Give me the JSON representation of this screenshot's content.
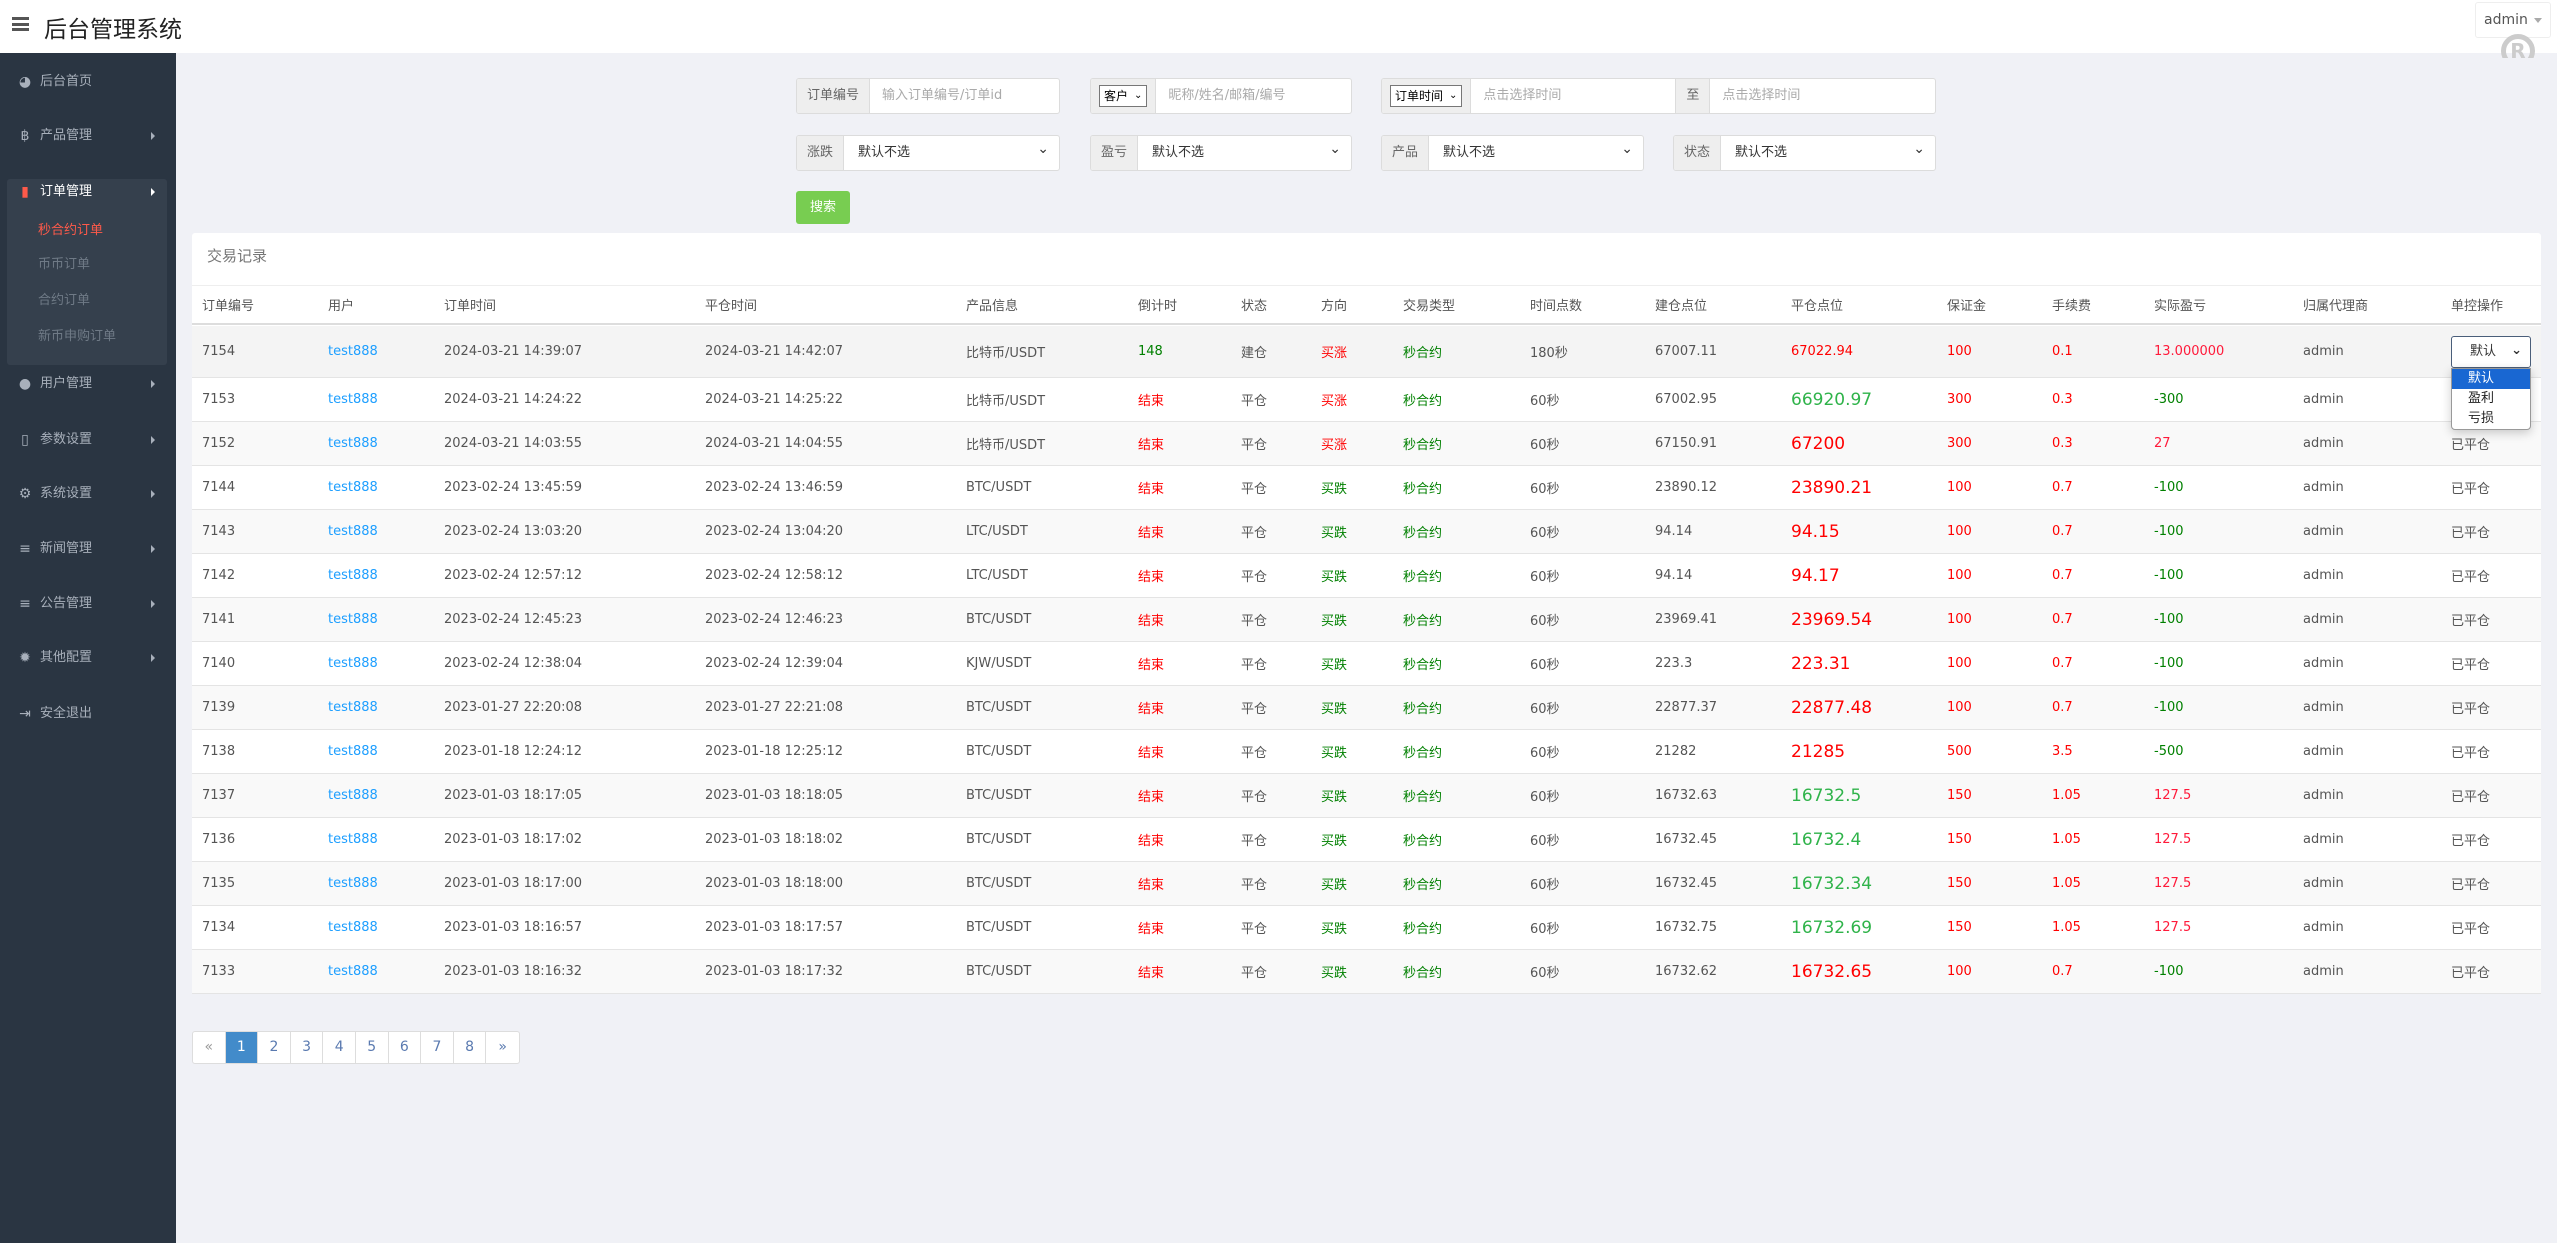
{
  "header": {
    "title": "后台管理系统",
    "user": "admin"
  },
  "sidebar": {
    "items": [
      {
        "label": "后台首页",
        "icon": "dashboard-icon",
        "glyph": "◕"
      },
      {
        "label": "产品管理",
        "icon": "bitcoin-icon",
        "glyph": "฿"
      },
      {
        "label": "订单管理",
        "icon": "files-icon",
        "glyph": "▮"
      },
      {
        "label": "用户管理",
        "icon": "user-icon",
        "glyph": "●"
      },
      {
        "label": "参数设置",
        "icon": "file-icon",
        "glyph": "▯"
      },
      {
        "label": "系统设置",
        "icon": "gears-icon",
        "glyph": "⚙"
      },
      {
        "label": "新闻管理",
        "icon": "list-icon",
        "glyph": "≡"
      },
      {
        "label": "公告管理",
        "icon": "list-icon",
        "glyph": "≡"
      },
      {
        "label": "其他配置",
        "icon": "gear-icon",
        "glyph": "✹"
      },
      {
        "label": "安全退出",
        "icon": "sign-out-icon",
        "glyph": "⇥"
      }
    ],
    "order_submenu": [
      "秒合约订单",
      "币币订单",
      "合约订单",
      "新币申购订单"
    ]
  },
  "filters": {
    "order_no_label": "订单编号",
    "order_no_placeholder": "输入订单编号/订单id",
    "customer_select": "客户",
    "customer_placeholder": "昵称/姓名/邮箱/编号",
    "time_select": "订单时间",
    "time_from_placeholder": "点击选择时间",
    "to_label": "至",
    "time_to_placeholder": "点击选择时间",
    "rise_fall_label": "涨跌",
    "profit_loss_label": "盈亏",
    "product_label": "产品",
    "status_label": "状态",
    "default_option": "默认不选",
    "search_button": "搜索"
  },
  "table": {
    "title": "交易记录",
    "columns": [
      "订单编号",
      "用户",
      "订单时间",
      "平仓时间",
      "产品信息",
      "倒计时",
      "状态",
      "方向",
      "交易类型",
      "时间点数",
      "建仓点位",
      "平仓点位",
      "保证金",
      "手续费",
      "实际盈亏",
      "归属代理商",
      "单控操作"
    ],
    "rows": [
      [
        "7154",
        "test888",
        "2024-03-21 14:39:07",
        "2024-03-21 14:42:07",
        "比特币/USDT",
        "148",
        "建仓",
        "买涨",
        "秒合约",
        "180秒",
        "67007.11",
        "67022.94",
        "100",
        "0.1",
        "13.000000",
        "admin",
        ""
      ],
      [
        "7153",
        "test888",
        "2024-03-21 14:24:22",
        "2024-03-21 14:25:22",
        "比特币/USDT",
        "结束",
        "平仓",
        "买涨",
        "秒合约",
        "60秒",
        "67002.95",
        "66920.97",
        "300",
        "0.3",
        "-300",
        "admin",
        ""
      ],
      [
        "7152",
        "test888",
        "2024-03-21 14:03:55",
        "2024-03-21 14:04:55",
        "比特币/USDT",
        "结束",
        "平仓",
        "买涨",
        "秒合约",
        "60秒",
        "67150.91",
        "67200",
        "300",
        "0.3",
        "27",
        "admin",
        "已平仓"
      ],
      [
        "7144",
        "test888",
        "2023-02-24 13:45:59",
        "2023-02-24 13:46:59",
        "BTC/USDT",
        "结束",
        "平仓",
        "买跌",
        "秒合约",
        "60秒",
        "23890.12",
        "23890.21",
        "100",
        "0.7",
        "-100",
        "admin",
        "已平仓"
      ],
      [
        "7143",
        "test888",
        "2023-02-24 13:03:20",
        "2023-02-24 13:04:20",
        "LTC/USDT",
        "结束",
        "平仓",
        "买跌",
        "秒合约",
        "60秒",
        "94.14",
        "94.15",
        "100",
        "0.7",
        "-100",
        "admin",
        "已平仓"
      ],
      [
        "7142",
        "test888",
        "2023-02-24 12:57:12",
        "2023-02-24 12:58:12",
        "LTC/USDT",
        "结束",
        "平仓",
        "买跌",
        "秒合约",
        "60秒",
        "94.14",
        "94.17",
        "100",
        "0.7",
        "-100",
        "admin",
        "已平仓"
      ],
      [
        "7141",
        "test888",
        "2023-02-24 12:45:23",
        "2023-02-24 12:46:23",
        "BTC/USDT",
        "结束",
        "平仓",
        "买跌",
        "秒合约",
        "60秒",
        "23969.41",
        "23969.54",
        "100",
        "0.7",
        "-100",
        "admin",
        "已平仓"
      ],
      [
        "7140",
        "test888",
        "2023-02-24 12:38:04",
        "2023-02-24 12:39:04",
        "KJW/USDT",
        "结束",
        "平仓",
        "买跌",
        "秒合约",
        "60秒",
        "223.3",
        "223.31",
        "100",
        "0.7",
        "-100",
        "admin",
        "已平仓"
      ],
      [
        "7139",
        "test888",
        "2023-01-27 22:20:08",
        "2023-01-27 22:21:08",
        "BTC/USDT",
        "结束",
        "平仓",
        "买跌",
        "秒合约",
        "60秒",
        "22877.37",
        "22877.48",
        "100",
        "0.7",
        "-100",
        "admin",
        "已平仓"
      ],
      [
        "7138",
        "test888",
        "2023-01-18 12:24:12",
        "2023-01-18 12:25:12",
        "BTC/USDT",
        "结束",
        "平仓",
        "买跌",
        "秒合约",
        "60秒",
        "21282",
        "21285",
        "500",
        "3.5",
        "-500",
        "admin",
        "已平仓"
      ],
      [
        "7137",
        "test888",
        "2023-01-03 18:17:05",
        "2023-01-03 18:18:05",
        "BTC/USDT",
        "结束",
        "平仓",
        "买跌",
        "秒合约",
        "60秒",
        "16732.63",
        "16732.5",
        "150",
        "1.05",
        "127.5",
        "admin",
        "已平仓"
      ],
      [
        "7136",
        "test888",
        "2023-01-03 18:17:02",
        "2023-01-03 18:18:02",
        "BTC/USDT",
        "结束",
        "平仓",
        "买跌",
        "秒合约",
        "60秒",
        "16732.45",
        "16732.4",
        "150",
        "1.05",
        "127.5",
        "admin",
        "已平仓"
      ],
      [
        "7135",
        "test888",
        "2023-01-03 18:17:00",
        "2023-01-03 18:18:00",
        "BTC/USDT",
        "结束",
        "平仓",
        "买跌",
        "秒合约",
        "60秒",
        "16732.45",
        "16732.34",
        "150",
        "1.05",
        "127.5",
        "admin",
        "已平仓"
      ],
      [
        "7134",
        "test888",
        "2023-01-03 18:16:57",
        "2023-01-03 18:17:57",
        "BTC/USDT",
        "结束",
        "平仓",
        "买跌",
        "秒合约",
        "60秒",
        "16732.75",
        "16732.69",
        "150",
        "1.05",
        "127.5",
        "admin",
        "已平仓"
      ],
      [
        "7133",
        "test888",
        "2023-01-03 18:16:32",
        "2023-01-03 18:17:32",
        "BTC/USDT",
        "结束",
        "平仓",
        "买跌",
        "秒合约",
        "60秒",
        "16732.62",
        "16732.65",
        "100",
        "0.7",
        "-100",
        "admin",
        "已平仓"
      ]
    ],
    "close_price_colors": [
      "red",
      "green",
      "red",
      "red",
      "red",
      "red",
      "red",
      "red",
      "red",
      "red",
      "green",
      "green",
      "green",
      "green",
      "red"
    ],
    "control_select": {
      "value": "默认",
      "options": [
        "默认",
        "盈利",
        "亏损"
      ],
      "highlighted": "默认"
    }
  },
  "pagination": {
    "prev": "«",
    "pages": [
      "1",
      "2",
      "3",
      "4",
      "5",
      "6",
      "7",
      "8"
    ],
    "current": "1",
    "next": "»"
  },
  "colors": {
    "accent_red": "#ff0000",
    "green": "#008000",
    "search_button": "#78cd51",
    "pager_active": "#428bca",
    "sidebar_bg": "#2a3542"
  }
}
